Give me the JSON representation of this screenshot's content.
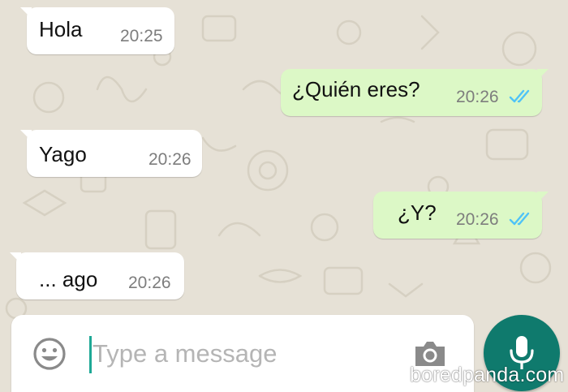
{
  "colors": {
    "wallpaper": "#e6e1d6",
    "incoming_bubble": "#ffffff",
    "outgoing_bubble": "#dcf8c6",
    "read_ticks": "#4fc3f7",
    "mic_button": "#0f7a6d",
    "cursor": "#1ea896"
  },
  "messages": [
    {
      "direction": "incoming",
      "text": "Hola",
      "time": "20:25"
    },
    {
      "direction": "outgoing",
      "text": "¿Quién eres?",
      "time": "20:26",
      "status_icon": "double-check-read-icon"
    },
    {
      "direction": "incoming",
      "text": "Yago",
      "time": "20:26"
    },
    {
      "direction": "outgoing",
      "text": "¿Y?",
      "time": "20:26",
      "status_icon": "double-check-read-icon"
    },
    {
      "direction": "incoming",
      "text": "... ago",
      "time": "20:26"
    }
  ],
  "composer": {
    "placeholder": "Type a message",
    "value": "",
    "emoji_icon": "emoji-icon",
    "camera_icon": "camera-icon",
    "mic_icon": "microphone-icon"
  },
  "watermark": "boredpanda.com"
}
